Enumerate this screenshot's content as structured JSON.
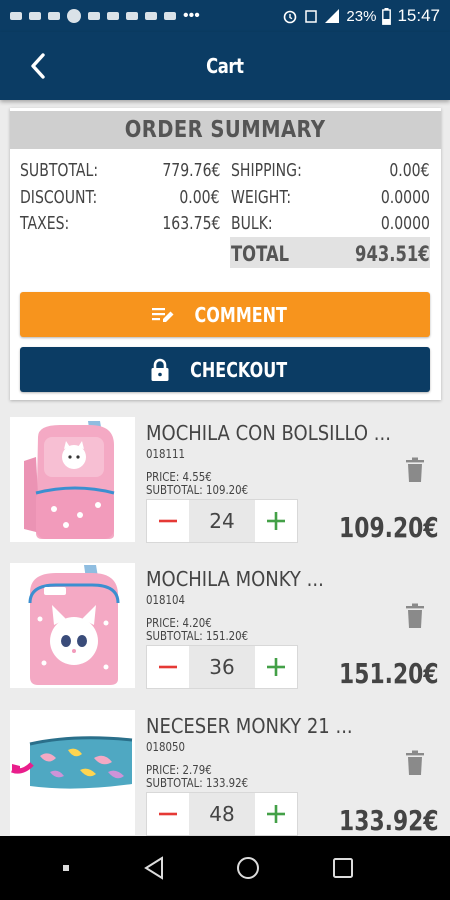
{
  "status_bar": {
    "battery": "23%",
    "time": "15:47"
  },
  "app_bar": {
    "title": "Cart"
  },
  "summary": {
    "title": "ORDER SUMMARY",
    "subtotal_label": "SUBTOTAL:",
    "subtotal_value": "779.76€",
    "discount_label": "DISCOUNT:",
    "discount_value": "0.00€",
    "taxes_label": "TAXES:",
    "taxes_value": "163.75€",
    "shipping_label": "SHIPPING:",
    "shipping_value": "0.00€",
    "weight_label": "WEIGHT:",
    "weight_value": "0.0000",
    "bulk_label": "BULK:",
    "bulk_value": "0.0000",
    "total_label": "TOTAL",
    "total_value": "943.51€"
  },
  "actions": {
    "comment_label": "COMMENT",
    "checkout_label": "CHECKOUT"
  },
  "products": [
    {
      "name": "MOCHILA CON BOLSILLO ...",
      "code": "018111",
      "price": "PRICE: 4.55€",
      "subtotal": "SUBTOTAL: 109.20€",
      "quantity": "24",
      "total": "109.20€"
    },
    {
      "name": "MOCHILA MONKY ...",
      "code": "018104",
      "price": "PRICE: 4.20€",
      "subtotal": "SUBTOTAL: 151.20€",
      "quantity": "36",
      "total": "151.20€"
    },
    {
      "name": "NECESER MONKY 21 ...",
      "code": "018050",
      "price": "PRICE: 2.79€",
      "subtotal": "SUBTOTAL: 133.92€",
      "quantity": "48",
      "total": "133.92€"
    }
  ],
  "colors": {
    "primary": "#0b3c64",
    "accent": "#f7941d",
    "minus": "#e53935",
    "plus": "#43a047"
  }
}
